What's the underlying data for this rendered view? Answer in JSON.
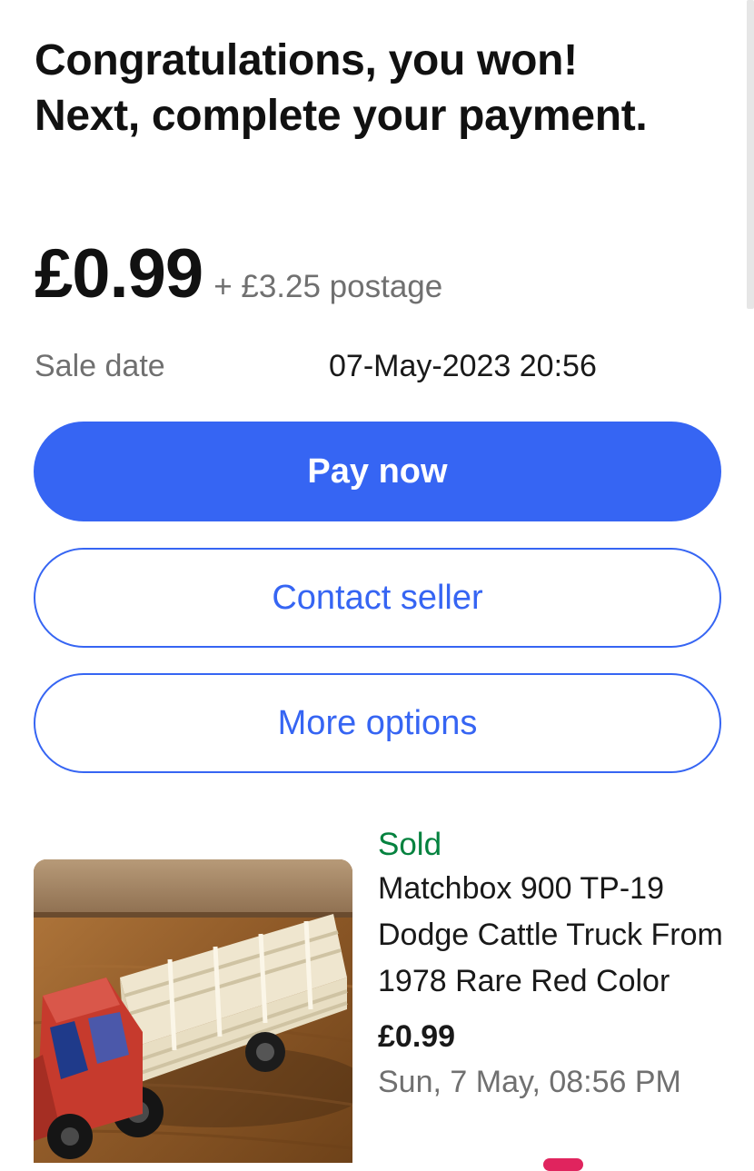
{
  "header": {
    "title": "Congratulations, you won! Next, complete your payment."
  },
  "price": {
    "amount": "£0.99",
    "postage": "+ £3.25 postage"
  },
  "sale": {
    "label": "Sale date",
    "value": "07-May-2023 20:56"
  },
  "actions": {
    "pay_now": "Pay now",
    "contact_seller": "Contact seller",
    "more_options": "More options"
  },
  "item": {
    "status": "Sold",
    "title": "Matchbox 900 TP-19 Dodge Cattle Truck From 1978 Rare Red Color",
    "price": "£0.99",
    "date": "Sun, 7 May, 08:56 PM",
    "image_subject": "red-toy-cattle-truck"
  },
  "colors": {
    "accent": "#3665f3",
    "sold_green": "#05823f",
    "secondary_text": "#707070"
  }
}
